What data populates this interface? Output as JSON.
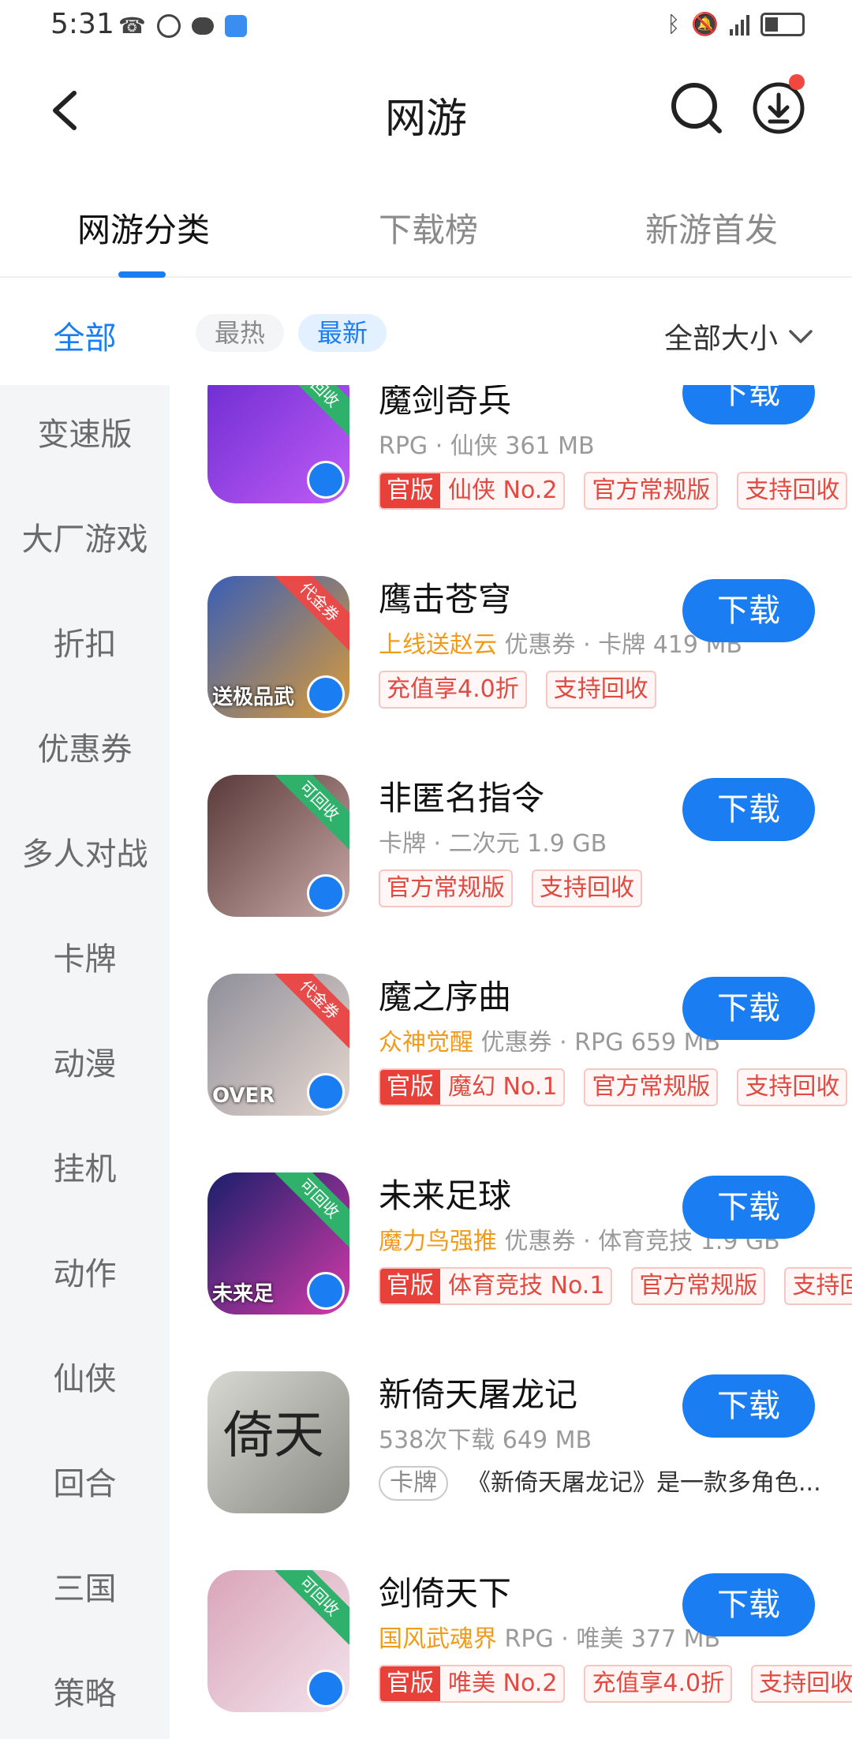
{
  "status": {
    "time": "5:31"
  },
  "header": {
    "title": "网游"
  },
  "tabs": [
    {
      "label": "网游分类"
    },
    {
      "label": "下载榜"
    },
    {
      "label": "新游首发"
    }
  ],
  "filters": {
    "category_selected": "全部",
    "chips": [
      "最热",
      "最新"
    ],
    "active_chip": "最新",
    "size_label": "全部大小"
  },
  "sidebar": [
    "变速版",
    "大厂游戏",
    "折扣",
    "优惠券",
    "多人对战",
    "卡牌",
    "动漫",
    "挂机",
    "动作",
    "仙侠",
    "回合",
    "三国",
    "策略"
  ],
  "games": [
    {
      "name": "魔剑奇兵",
      "meta_prefix": "",
      "meta": "RPG · 仙侠  361 MB",
      "corner": "可回收",
      "corner_color": "#2fb06b",
      "tags": [
        {
          "official": "官版",
          "text": "仙侠 No.2"
        },
        {
          "text": "官方常规版"
        },
        {
          "text": "支持回收"
        }
      ],
      "button": "下载",
      "colors": [
        "#6a2bd1",
        "#c05cf5"
      ]
    },
    {
      "name": "鹰击苍穹",
      "meta_prefix": "上线送赵云",
      "meta": "优惠券 · 卡牌  419 MB",
      "corner": "代金券",
      "corner_color": "#e84a4a",
      "tags": [
        {
          "text": "充值享4.0折"
        },
        {
          "text": "支持回收"
        }
      ],
      "button": "下载",
      "colors": [
        "#3a5fb5",
        "#d99a3a"
      ],
      "icon_text": "送极品武"
    },
    {
      "name": "非匿名指令",
      "meta_prefix": "",
      "meta": "卡牌 · 二次元  1.9 GB",
      "corner": "可回收",
      "corner_color": "#2fb06b",
      "tags": [
        {
          "text": "官方常规版"
        },
        {
          "text": "支持回收"
        }
      ],
      "button": "下载",
      "colors": [
        "#5a3a3a",
        "#c9a9a6"
      ]
    },
    {
      "name": "魔之序曲",
      "meta_prefix": "众神觉醒",
      "meta": "优惠券 · RPG  659 MB",
      "corner": "代金券",
      "corner_color": "#e84a4a",
      "tags": [
        {
          "official": "官版",
          "text": "魔幻 No.1"
        },
        {
          "text": "官方常规版"
        },
        {
          "text": "支持回收"
        }
      ],
      "button": "下载",
      "colors": [
        "#8f8f9a",
        "#e6d8cf"
      ],
      "icon_text": "OVER"
    },
    {
      "name": "未来足球",
      "meta_prefix": "魔力鸟强推",
      "meta": "优惠券 · 体育竞技  1.9 GB",
      "corner": "可回收",
      "corner_color": "#2fb06b",
      "tags": [
        {
          "official": "官版",
          "text": "体育竞技 No.1"
        },
        {
          "text": "官方常规版"
        },
        {
          "text": "支持回"
        }
      ],
      "button": "下载",
      "colors": [
        "#1b1f6b",
        "#d23aa8"
      ],
      "icon_text": "未来足"
    },
    {
      "name": "新倚天屠龙记",
      "meta_prefix": "",
      "meta": "538次下载  649 MB",
      "corner": "",
      "corner_color": "",
      "tags": [],
      "genre": "卡牌",
      "desc": "《新倚天屠龙记》是一款多角色...",
      "button": "下载",
      "colors": [
        "#d8d8d2",
        "#8a8a84"
      ],
      "icon_text": "倚天"
    },
    {
      "name": "剑倚天下",
      "meta_prefix": "国风武魂界",
      "meta": "RPG · 唯美  377 MB",
      "corner": "可回收",
      "corner_color": "#2fb06b",
      "tags": [
        {
          "official": "官版",
          "text": "唯美 No.2"
        },
        {
          "text": "充值享4.0折"
        },
        {
          "text": "支持回收"
        }
      ],
      "button": "下载",
      "colors": [
        "#d9a5b8",
        "#f3e3ec"
      ]
    }
  ]
}
